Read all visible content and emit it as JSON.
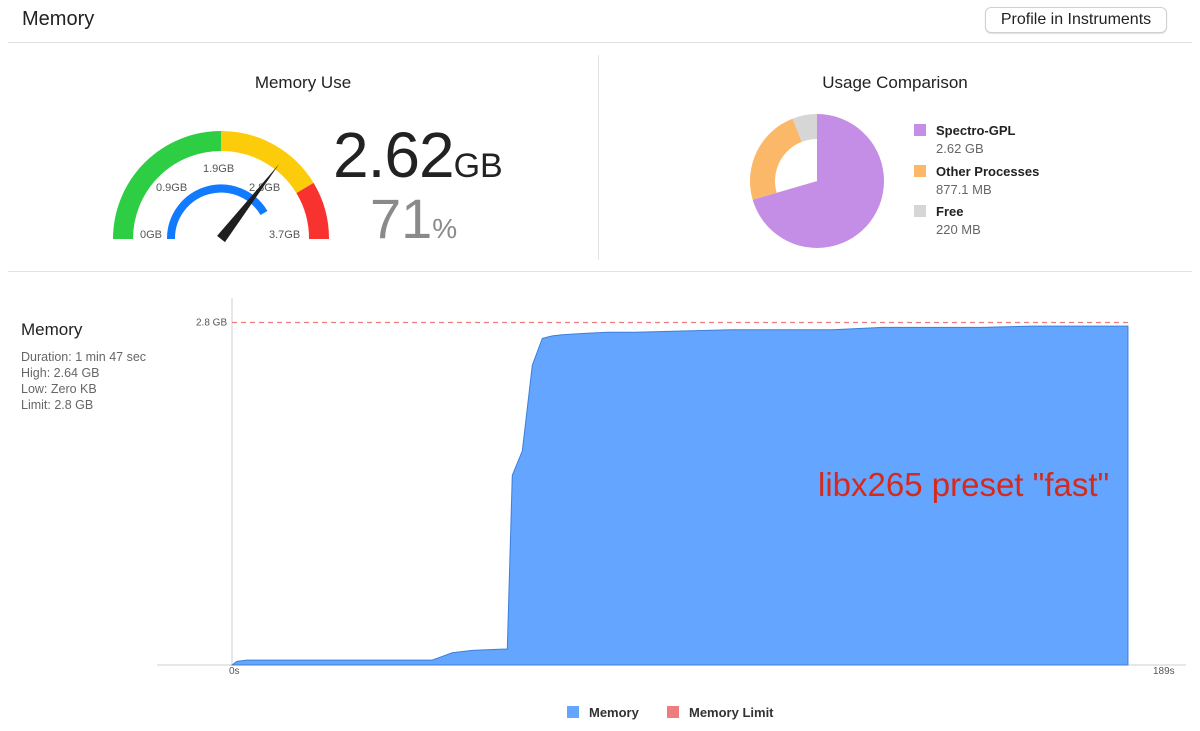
{
  "header": {
    "title": "Memory",
    "profile_button_label": "Profile in Instruments"
  },
  "memory_use": {
    "title": "Memory Use",
    "gauge": {
      "tick_labels": [
        "0GB",
        "0.9GB",
        "1.9GB",
        "2.8GB",
        "3.7GB"
      ],
      "needle_fraction": 0.71,
      "value": "2.62",
      "unit": "GB",
      "percent": "71",
      "percent_sign": "%"
    }
  },
  "usage_comparison": {
    "title": "Usage Comparison",
    "items": [
      {
        "name": "Spectro-GPL",
        "value": "2.62 GB",
        "color": "#c58ee6",
        "amount_gb": 2.62
      },
      {
        "name": "Other Processes",
        "value": "877.1 MB",
        "color": "#fbb869",
        "amount_gb": 0.8771
      },
      {
        "name": "Free",
        "value": "220 MB",
        "color": "#d6d6d6",
        "amount_gb": 0.22
      }
    ]
  },
  "memory_stats": {
    "title": "Memory",
    "duration": "Duration: 1 min 47 sec",
    "high": "High: 2.64 GB",
    "low": "Low: Zero KB",
    "limit": "Limit: 2.8 GB"
  },
  "chart_data": {
    "type": "area",
    "x_unit": "s",
    "xlim": [
      0,
      189
    ],
    "ylim": [
      0,
      3.0
    ],
    "x_tick_labels": [
      "0s",
      "189s"
    ],
    "limit_label": "2.8 GB",
    "limit_value": 2.8,
    "series": [
      {
        "name": "Memory",
        "color": "#64a6ff",
        "x": [
          0,
          1,
          3,
          15,
          30,
          40,
          42,
          44,
          48,
          54,
          55,
          56,
          58,
          60,
          62,
          63,
          64,
          66,
          70,
          75,
          80,
          90,
          100,
          110,
          120,
          130,
          140,
          150,
          160,
          170,
          175,
          178,
          179
        ],
        "y": [
          0,
          0.03,
          0.04,
          0.04,
          0.04,
          0.04,
          0.07,
          0.1,
          0.12,
          0.13,
          0.13,
          1.55,
          1.75,
          2.45,
          2.67,
          2.68,
          2.69,
          2.7,
          2.71,
          2.72,
          2.72,
          2.73,
          2.74,
          2.74,
          2.74,
          2.76,
          2.76,
          2.76,
          2.77,
          2.77,
          2.77,
          2.77,
          2.77
        ]
      }
    ],
    "legend": [
      "Memory",
      "Memory Limit"
    ],
    "legend_colors": [
      "#64a6ff",
      "#ef7d7d"
    ],
    "legend_position": "bottom",
    "annotation": "libx265 preset \"fast\""
  }
}
